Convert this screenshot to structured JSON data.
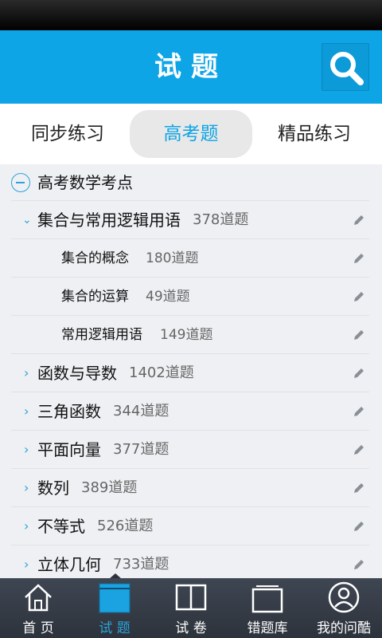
{
  "header": {
    "title": "试题",
    "search_icon": "search-icon"
  },
  "tabs": [
    {
      "label": "同步练习"
    },
    {
      "label": "高考题",
      "active": true
    },
    {
      "label": "精品练习"
    }
  ],
  "tree": {
    "root": "高考数学考点",
    "items": [
      {
        "name": "集合与常用逻辑用语",
        "count": "378道题",
        "expanded": true
      },
      {
        "name": "集合的概念",
        "count": "180道题",
        "child": true
      },
      {
        "name": "集合的运算",
        "count": "49道题",
        "child": true
      },
      {
        "name": "常用逻辑用语",
        "count": "149道题",
        "child": true
      },
      {
        "name": "函数与导数",
        "count": "1402道题"
      },
      {
        "name": "三角函数",
        "count": "344道题"
      },
      {
        "name": "平面向量",
        "count": "377道题"
      },
      {
        "name": "数列",
        "count": "389道题"
      },
      {
        "name": "不等式",
        "count": "526道题"
      },
      {
        "name": "立体几何",
        "count": "733道题"
      }
    ]
  },
  "nav": [
    {
      "label": "首 页",
      "icon": "home-icon"
    },
    {
      "label": "试 题",
      "icon": "document-icon",
      "active": true
    },
    {
      "label": "试 卷",
      "icon": "book-icon"
    },
    {
      "label": "错题库",
      "icon": "folder-icon"
    },
    {
      "label": "我的问酷",
      "icon": "profile-icon"
    }
  ],
  "colors": {
    "accent": "#0ea5e6",
    "nav_bg": "#2d333c"
  }
}
